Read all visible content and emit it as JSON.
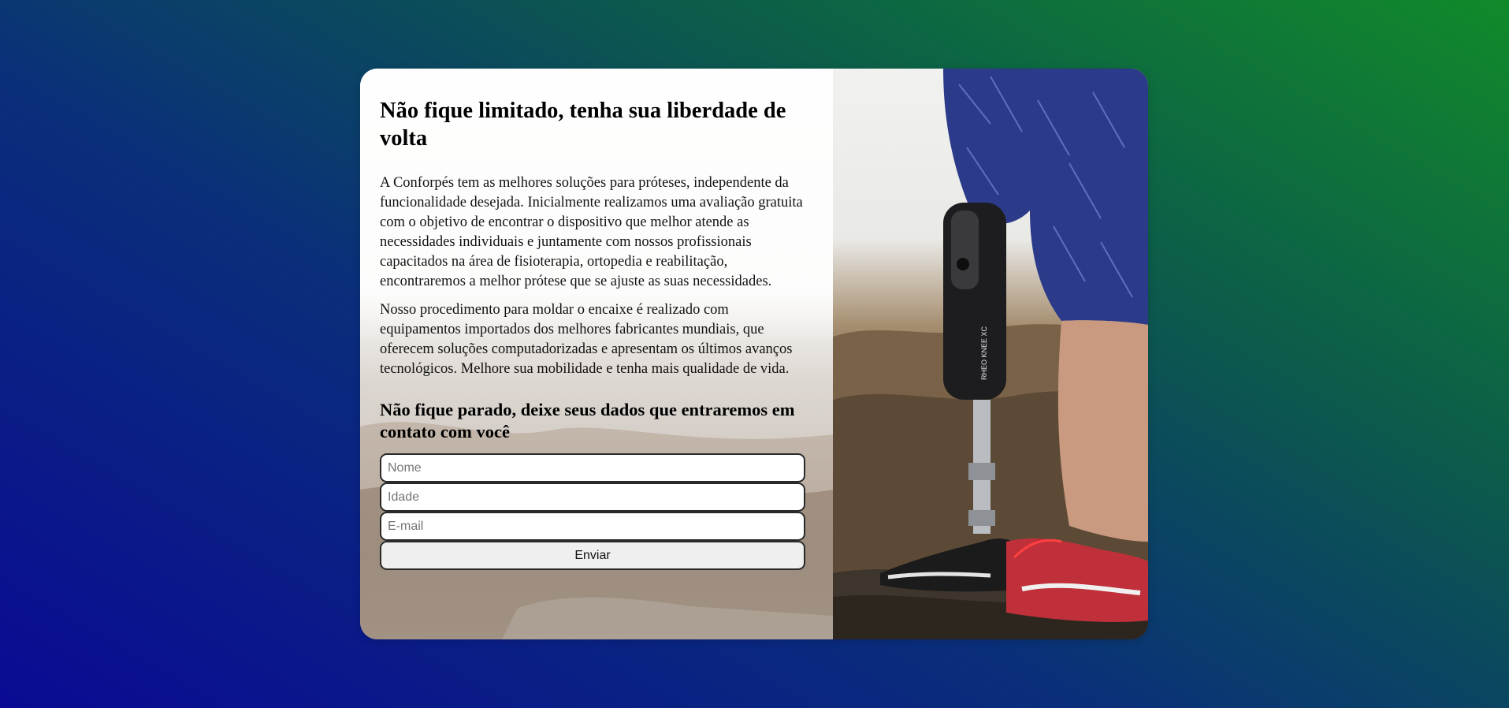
{
  "card": {
    "title": "Não fique limitado, tenha sua liberdade de volta",
    "paragraphs": [
      "A Conforpés tem as melhores soluções para próteses, independente da funcionalidade desejada. Inicialmente realizamos uma avaliação gratuita com o objetivo de encontrar o dispositivo que melhor atende as necessidades individuais e juntamente com nossos profissionais capacitados na área de fisioterapia, ortopedia e reabilitação, encontraremos a melhor prótese que se ajuste as suas necessidades.",
      "Nosso procedimento para moldar o encaixe é realizado com equipamentos importados dos melhores fabricantes mundiais, que oferecem soluções computadorizadas e apresentam os últimos avanços tecnológicos. Melhore sua mobilidade e tenha mais qualidade de vida."
    ],
    "form_title": "Não fique parado, deixe seus dados que entraremos em contato com você"
  },
  "form": {
    "name_placeholder": "Nome",
    "age_placeholder": "Idade",
    "email_placeholder": "E-mail",
    "submit_label": "Enviar"
  },
  "photo": {
    "knee_brand": "RHEO KNEE XC"
  },
  "colors": {
    "background_start": "#0a0a94",
    "background_end": "#118a2a"
  }
}
